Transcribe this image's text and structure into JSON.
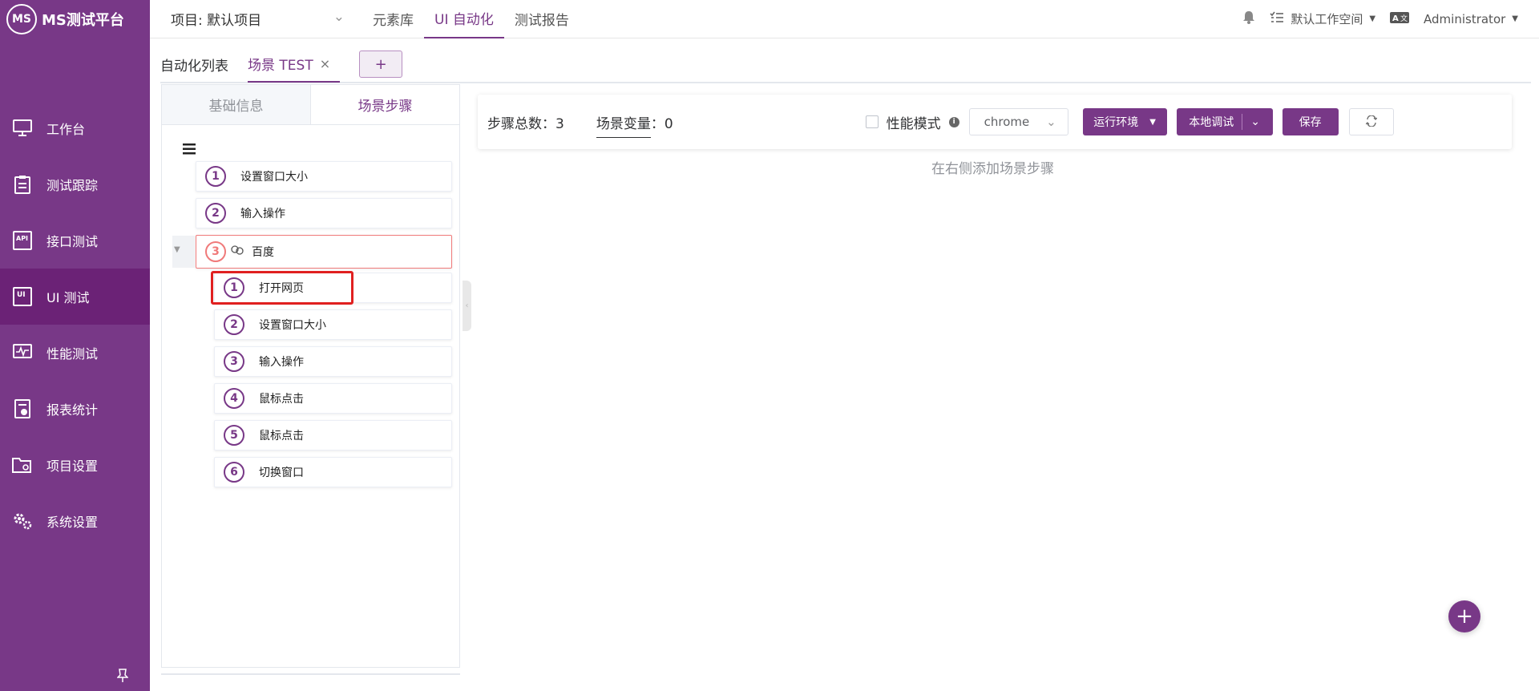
{
  "sidebar": {
    "logo_mark": "MS",
    "logo_text": "MS测试平台",
    "items": [
      {
        "label": "工作台",
        "icon": "monitor-icon"
      },
      {
        "label": "测试跟踪",
        "icon": "clipboard-icon"
      },
      {
        "label": "接口测试",
        "icon": "api-icon"
      },
      {
        "label": "UI 测试",
        "icon": "ui-icon"
      },
      {
        "label": "性能测试",
        "icon": "performance-icon"
      },
      {
        "label": "报表统计",
        "icon": "report-icon"
      },
      {
        "label": "项目设置",
        "icon": "folder-settings-icon"
      },
      {
        "label": "系统设置",
        "icon": "gears-icon"
      }
    ],
    "active_index": 3
  },
  "topbar": {
    "project": "项目: 默认项目",
    "menus": [
      "元素库",
      "UI 自动化",
      "测试报告"
    ],
    "active_menu": 1,
    "workspace": "默认工作空间",
    "user": "Administrator"
  },
  "tabs": {
    "list_tab": "自动化列表",
    "scenario_tab": "场景 TEST",
    "close_glyph": "×",
    "add_glyph": "+"
  },
  "panel": {
    "tab_basic": "基础信息",
    "tab_steps": "场景步骤",
    "steps": [
      {
        "num": "1",
        "label": "设置窗口大小"
      },
      {
        "num": "2",
        "label": "输入操作"
      },
      {
        "num": "3",
        "label": "百度",
        "scenario": true
      }
    ],
    "sub_steps": [
      {
        "num": "1",
        "label": "打开网页"
      },
      {
        "num": "2",
        "label": "设置窗口大小"
      },
      {
        "num": "3",
        "label": "输入操作"
      },
      {
        "num": "4",
        "label": "鼠标点击"
      },
      {
        "num": "5",
        "label": "鼠标点击"
      },
      {
        "num": "6",
        "label": "切换窗口"
      }
    ]
  },
  "toolbar": {
    "step_total": "步骤总数：3",
    "scene_var_label": "场景变量",
    "scene_var_value": "：0",
    "perf_mode": "性能模式",
    "browser": "chrome",
    "run_env": "运行环境",
    "local_debug": "本地调试",
    "save": "保存"
  },
  "empty_hint": "在右侧添加场景步骤"
}
